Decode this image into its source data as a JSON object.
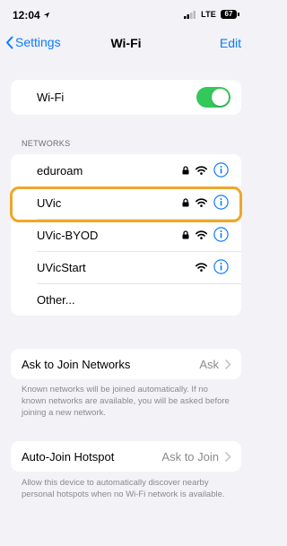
{
  "status_bar": {
    "time": "12:04",
    "network": "LTE",
    "battery": "67"
  },
  "nav": {
    "back_label": "Settings",
    "title": "Wi-Fi",
    "edit_label": "Edit"
  },
  "wifi_toggle": {
    "label": "Wi-Fi",
    "on": true
  },
  "networks_header": "NETWORKS",
  "networks": [
    {
      "name": "eduroam",
      "locked": true
    },
    {
      "name": "UVic",
      "locked": true
    },
    {
      "name": "UVic-BYOD",
      "locked": true
    },
    {
      "name": "UVicStart",
      "locked": false
    },
    {
      "name": "Other...",
      "locked": false
    }
  ],
  "ask_to_join": {
    "label": "Ask to Join Networks",
    "value": "Ask",
    "footnote": "Known networks will be joined automatically. If no known networks are available, you will be asked before joining a new network."
  },
  "auto_join_hotspot": {
    "label": "Auto-Join Hotspot",
    "value": "Ask to Join",
    "footnote": "Allow this device to automatically discover nearby personal hotspots when no Wi-Fi network is available."
  },
  "colors": {
    "accent": "#0a7aff",
    "toggle_on": "#34c759",
    "highlight": "#eea72a",
    "background": "#f2f2f7"
  }
}
